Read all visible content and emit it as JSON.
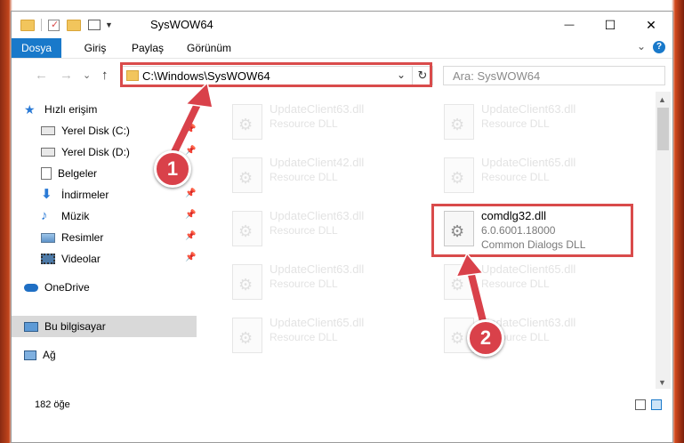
{
  "window": {
    "title": "SysWOW64",
    "controls": {
      "minimize": "—",
      "maximize": "☐",
      "close": "✕"
    }
  },
  "ribbon": {
    "tabs": [
      {
        "label": "Dosya",
        "active": true
      },
      {
        "label": "Giriş",
        "active": false
      },
      {
        "label": "Paylaş",
        "active": false
      },
      {
        "label": "Görünüm",
        "active": false
      }
    ],
    "help": "?"
  },
  "nav": {
    "back": "←",
    "forward": "→",
    "recent": "⌄",
    "up": "↑",
    "address": "C:\\Windows\\SysWOW64",
    "search_placeholder": "Ara: SysWOW64"
  },
  "sidebar": {
    "items": [
      {
        "label": "Hızlı erişim",
        "icon": "star-icon"
      },
      {
        "label": "Yerel Disk (C:)",
        "icon": "drive-icon"
      },
      {
        "label": "Yerel Disk (D:)",
        "icon": "drive-icon"
      },
      {
        "label": "Belgeler",
        "icon": "documents-icon"
      },
      {
        "label": "İndirmeler",
        "icon": "download-icon"
      },
      {
        "label": "Müzik",
        "icon": "music-icon"
      },
      {
        "label": "Resimler",
        "icon": "pictures-icon"
      },
      {
        "label": "Videolar",
        "icon": "video-icon"
      },
      {
        "label": "OneDrive",
        "icon": "cloud-icon"
      },
      {
        "label": "Bu bilgisayar",
        "icon": "computer-icon"
      },
      {
        "label": "Ağ",
        "icon": "network-icon"
      }
    ]
  },
  "files": [
    {
      "name": "UpdateClient63.dll",
      "sub1": "Resource DLL"
    },
    {
      "name": "UpdateClient63.dll",
      "sub1": "Resource DLL"
    },
    {
      "name": "UpdateClient42.dll",
      "sub1": "Resource DLL"
    },
    {
      "name": "UpdateClient65.dll",
      "sub1": "Resource DLL"
    },
    {
      "name": "UpdateClient63.dll",
      "sub1": "Resource DLL"
    },
    {
      "name": "comdlg32.dll",
      "sub1": "6.0.6001.18000",
      "sub2": "Common Dialogs DLL"
    },
    {
      "name": "UpdateClient63.dll",
      "sub1": "Resource DLL"
    },
    {
      "name": "UpdateClient65.dll",
      "sub1": "Resource DLL"
    },
    {
      "name": "UpdateClient65.dll",
      "sub1": "Resource DLL"
    },
    {
      "name": "UpdateClient63.dll",
      "sub1": "Resource DLL"
    }
  ],
  "status": {
    "count": "182 öğe"
  },
  "annotations": {
    "step1": "1",
    "step2": "2"
  },
  "colors": {
    "accent": "#1979ca",
    "highlight": "#d94b4b"
  }
}
